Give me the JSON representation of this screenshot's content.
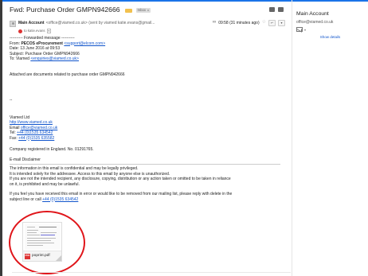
{
  "header": {
    "subject": "Fwd: Purchase Order GMPN942666",
    "label_chip": "Inbox",
    "label_chip_close": "x",
    "label_color": "#f2c14e"
  },
  "sender": {
    "name": "Main Account",
    "meta": "<office@viamed.co.uk> (sent by viamed katie.evans@gmail...",
    "time": "09:58 (31 minutes ago)",
    "star": "☆",
    "reply": "↩",
    "more": "▾",
    "to": "to katie.evans",
    "to_caret": "▾"
  },
  "body": {
    "fwd_marker": "---------- Forwarded message ----------",
    "from_prefix": "From: ",
    "from_name": "PECOS eProcurement",
    "from_email": "<support@elcom.com>",
    "date": "Date: 13 June 2016 at 09:53",
    "subject": "Subject: Purchase Order GMPN942666",
    "to_prefix": "To: Viamed ",
    "to_email": "<enquiries@viamed.co.uk>",
    "intro": "Attached are documents related to purchase order GMPN942666",
    "sig_sep": "--",
    "company": "Viamed Ltd",
    "website": "http://www.viamed.co.uk",
    "email_prefix": "Email ",
    "email": "office@viamed.co.uk",
    "tel_prefix": "Tel:  ",
    "tel": "+44 (0)1535 634542",
    "fax_prefix": "Fax:  ",
    "fax": "+44 (0)1535 635582",
    "registered": "Company registered in England. No. 01291765.",
    "disclaimer_title": "E-mail Disclaimer",
    "disclaimer_1": "The information in this email is confidential and may be legally privileged.",
    "disclaimer_2": "It is intended solely for the addressee. Access to this email by anyone else is unauthorized.",
    "disclaimer_3": "If you are not the intended recipient, any disclosure, copying, distribution or any action taken or omitted to be taken in reliance",
    "disclaimer_4": "on it, is prohibited and may be unlawful.",
    "error_1": "If you feel you have received this email in error or would like to be removed from our mailing list, please reply with delete in the",
    "error_2_prefix": "subject line or call ",
    "error_2_phone": "+44 (0)1535 634542"
  },
  "attachment": {
    "filename": "poprint.pdf",
    "type_badge": "PDF"
  },
  "sidebar": {
    "name": "Main Account",
    "email": "office@viamed.co.uk",
    "caret": "▾",
    "show_details": "Show details"
  },
  "colors": {
    "link": "#1155cc",
    "highlight": "#e0151a",
    "accent": "#1a73e8"
  }
}
